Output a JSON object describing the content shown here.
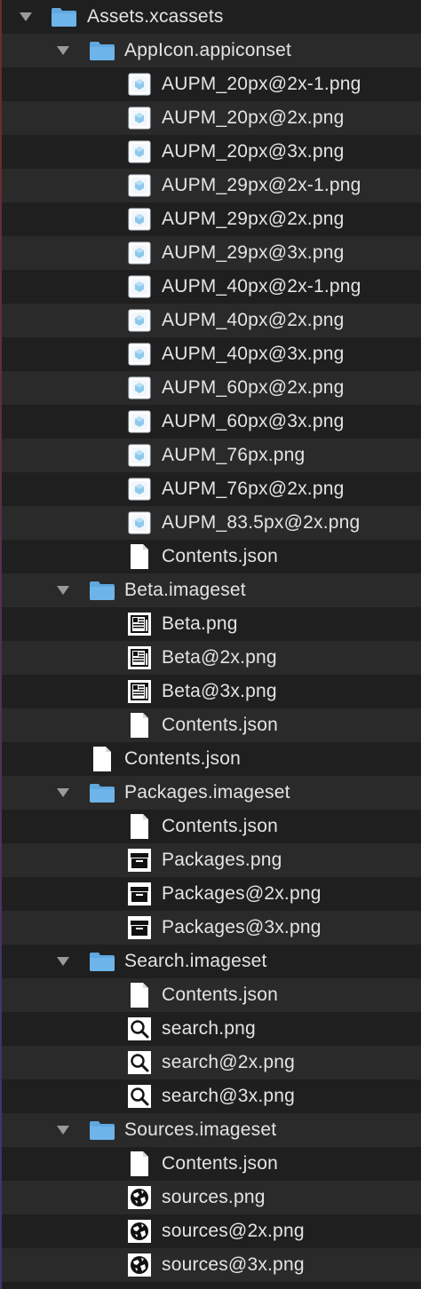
{
  "tree": {
    "rows": [
      {
        "level": 0,
        "type": "folder",
        "expanded": true,
        "label": "Assets.xcassets",
        "icon": "folder-icon"
      },
      {
        "level": 1,
        "type": "folder",
        "expanded": true,
        "label": "AppIcon.appiconset",
        "icon": "folder-icon"
      },
      {
        "level": 2,
        "type": "file",
        "label": "AUPM_20px@2x-1.png",
        "icon": "app-icon-thumbnail-icon"
      },
      {
        "level": 2,
        "type": "file",
        "label": "AUPM_20px@2x.png",
        "icon": "app-icon-thumbnail-icon"
      },
      {
        "level": 2,
        "type": "file",
        "label": "AUPM_20px@3x.png",
        "icon": "app-icon-thumbnail-icon"
      },
      {
        "level": 2,
        "type": "file",
        "label": "AUPM_29px@2x-1.png",
        "icon": "app-icon-thumbnail-icon"
      },
      {
        "level": 2,
        "type": "file",
        "label": "AUPM_29px@2x.png",
        "icon": "app-icon-thumbnail-icon"
      },
      {
        "level": 2,
        "type": "file",
        "label": "AUPM_29px@3x.png",
        "icon": "app-icon-thumbnail-icon"
      },
      {
        "level": 2,
        "type": "file",
        "label": "AUPM_40px@2x-1.png",
        "icon": "app-icon-thumbnail-icon"
      },
      {
        "level": 2,
        "type": "file",
        "label": "AUPM_40px@2x.png",
        "icon": "app-icon-thumbnail-icon"
      },
      {
        "level": 2,
        "type": "file",
        "label": "AUPM_40px@3x.png",
        "icon": "app-icon-thumbnail-icon"
      },
      {
        "level": 2,
        "type": "file",
        "label": "AUPM_60px@2x.png",
        "icon": "app-icon-thumbnail-icon"
      },
      {
        "level": 2,
        "type": "file",
        "label": "AUPM_60px@3x.png",
        "icon": "app-icon-thumbnail-icon"
      },
      {
        "level": 2,
        "type": "file",
        "label": "AUPM_76px.png",
        "icon": "app-icon-thumbnail-icon"
      },
      {
        "level": 2,
        "type": "file",
        "label": "AUPM_76px@2x.png",
        "icon": "app-icon-thumbnail-icon"
      },
      {
        "level": 2,
        "type": "file",
        "label": "AUPM_83.5px@2x.png",
        "icon": "app-icon-thumbnail-icon"
      },
      {
        "level": 2,
        "type": "file",
        "label": "Contents.json",
        "icon": "document-icon"
      },
      {
        "level": 1,
        "type": "folder",
        "expanded": true,
        "label": "Beta.imageset",
        "icon": "folder-icon"
      },
      {
        "level": 2,
        "type": "file",
        "label": "Beta.png",
        "icon": "newspaper-icon"
      },
      {
        "level": 2,
        "type": "file",
        "label": "Beta@2x.png",
        "icon": "newspaper-icon"
      },
      {
        "level": 2,
        "type": "file",
        "label": "Beta@3x.png",
        "icon": "newspaper-icon"
      },
      {
        "level": 2,
        "type": "file",
        "label": "Contents.json",
        "icon": "document-icon"
      },
      {
        "level": 1,
        "type": "file",
        "label": "Contents.json",
        "icon": "document-icon"
      },
      {
        "level": 1,
        "type": "folder",
        "expanded": true,
        "label": "Packages.imageset",
        "icon": "folder-icon"
      },
      {
        "level": 2,
        "type": "file",
        "label": "Contents.json",
        "icon": "document-icon"
      },
      {
        "level": 2,
        "type": "file",
        "label": "Packages.png",
        "icon": "archive-box-icon"
      },
      {
        "level": 2,
        "type": "file",
        "label": "Packages@2x.png",
        "icon": "archive-box-icon"
      },
      {
        "level": 2,
        "type": "file",
        "label": "Packages@3x.png",
        "icon": "archive-box-icon"
      },
      {
        "level": 1,
        "type": "folder",
        "expanded": true,
        "label": "Search.imageset",
        "icon": "folder-icon"
      },
      {
        "level": 2,
        "type": "file",
        "label": "Contents.json",
        "icon": "document-icon"
      },
      {
        "level": 2,
        "type": "file",
        "label": "search.png",
        "icon": "magnifier-icon"
      },
      {
        "level": 2,
        "type": "file",
        "label": "search@2x.png",
        "icon": "magnifier-icon"
      },
      {
        "level": 2,
        "type": "file",
        "label": "search@3x.png",
        "icon": "magnifier-icon"
      },
      {
        "level": 1,
        "type": "folder",
        "expanded": true,
        "label": "Sources.imageset",
        "icon": "folder-icon"
      },
      {
        "level": 2,
        "type": "file",
        "label": "Contents.json",
        "icon": "document-icon"
      },
      {
        "level": 2,
        "type": "file",
        "label": "sources.png",
        "icon": "globe-icon"
      },
      {
        "level": 2,
        "type": "file",
        "label": "sources@2x.png",
        "icon": "globe-icon"
      },
      {
        "level": 2,
        "type": "file",
        "label": "sources@3x.png",
        "icon": "globe-icon"
      }
    ]
  },
  "colors": {
    "background_dark": "#1f1f1f",
    "background_stripe": "#2a2a2a",
    "text": "#e4e4e4",
    "folder_blue": "#5fa8e0",
    "disclosure_gray": "#9a9a9a"
  }
}
